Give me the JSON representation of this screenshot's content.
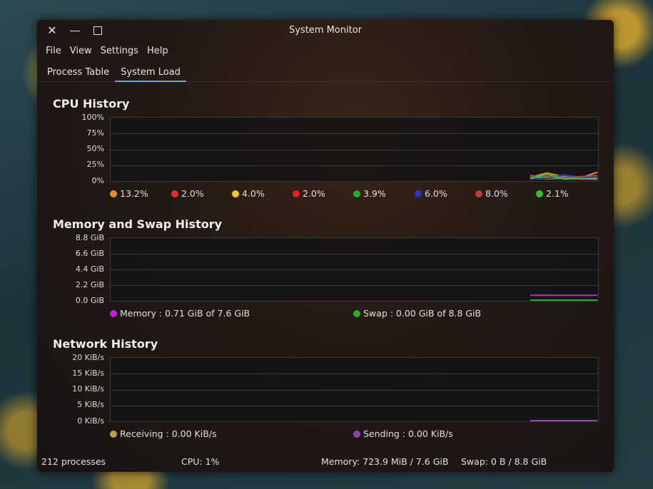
{
  "window": {
    "title": "System Monitor"
  },
  "menu": [
    "File",
    "View",
    "Settings",
    "Help"
  ],
  "tabs": [
    {
      "label": "Process Table",
      "active": false
    },
    {
      "label": "System Load",
      "active": true
    }
  ],
  "cpu": {
    "title": "CPU History",
    "y_ticks": [
      "100%",
      "75%",
      "50%",
      "25%",
      "0%"
    ],
    "legend": [
      {
        "value": "13.2%",
        "color": "#f08a24"
      },
      {
        "value": "2.0%",
        "color": "#e03131"
      },
      {
        "value": "4.0%",
        "color": "#f5c518"
      },
      {
        "value": "2.0%",
        "color": "#e82020"
      },
      {
        "value": "3.9%",
        "color": "#22b02a"
      },
      {
        "value": "6.0%",
        "color": "#2238c8"
      },
      {
        "value": "8.0%",
        "color": "#c23a3a"
      },
      {
        "value": "2.1%",
        "color": "#33c23a"
      }
    ]
  },
  "memory": {
    "title": "Memory and Swap History",
    "y_ticks": [
      "8.8 GiB",
      "6.6 GiB",
      "4.4 GiB",
      "2.2 GiB",
      "0.0 GiB"
    ],
    "legend": [
      {
        "label": "Memory : 0.71 GiB of 7.6 GiB",
        "color": "#c51ecf"
      },
      {
        "label": "Swap : 0.00 GiB of 8.8 GiB",
        "color": "#22b02a"
      }
    ]
  },
  "network": {
    "title": "Network History",
    "y_ticks": [
      "20 KiB/s",
      "15 KiB/s",
      "10 KiB/s",
      "5 KiB/s",
      "0 KiB/s"
    ],
    "legend": [
      {
        "label": "Receiving : 0.00 KiB/s",
        "color": "#b5a23a"
      },
      {
        "label": "Sending : 0.00 KiB/s",
        "color": "#8e44ad"
      }
    ]
  },
  "statusbar": {
    "processes": "212 processes",
    "cpu": "CPU: 1%",
    "memory": "Memory: 723.9 MiB / 7.6 GiB",
    "swap": "Swap: 0 B / 8.8 GiB"
  },
  "chart_data": [
    {
      "type": "line",
      "title": "CPU History",
      "ylim": [
        0,
        100
      ],
      "series": [
        {
          "color": "#f08a24",
          "values": [
            5,
            12,
            6,
            4,
            13.2
          ]
        },
        {
          "color": "#e03131",
          "values": [
            3,
            2,
            4,
            2,
            2.0
          ]
        },
        {
          "color": "#f5c518",
          "values": [
            2,
            6,
            3,
            5,
            4.0
          ]
        },
        {
          "color": "#e82020",
          "values": [
            4,
            2,
            3,
            2,
            2.0
          ]
        },
        {
          "color": "#22b02a",
          "values": [
            8,
            4,
            3,
            4,
            3.9
          ]
        },
        {
          "color": "#2238c8",
          "values": [
            2,
            3,
            9,
            5,
            6.0
          ]
        },
        {
          "color": "#c23a3a",
          "values": [
            6,
            7,
            5,
            6,
            8.0
          ]
        },
        {
          "color": "#33c23a",
          "values": [
            3,
            10,
            2,
            3,
            2.1
          ]
        }
      ]
    },
    {
      "type": "line",
      "title": "Memory and Swap History",
      "ylim": [
        0,
        8.8
      ],
      "series": [
        {
          "name": "Memory",
          "color": "#c51ecf",
          "values": [
            0.71,
            0.71
          ]
        },
        {
          "name": "Swap",
          "color": "#22b02a",
          "values": [
            0.0,
            0.0
          ]
        }
      ]
    },
    {
      "type": "line",
      "title": "Network History",
      "ylim": [
        0,
        20
      ],
      "series": [
        {
          "name": "Receiving",
          "color": "#f5e642",
          "values": [
            0.0,
            0.0
          ]
        },
        {
          "name": "Sending",
          "color": "#8e44ad",
          "values": [
            0.0,
            0.0
          ]
        }
      ]
    }
  ]
}
